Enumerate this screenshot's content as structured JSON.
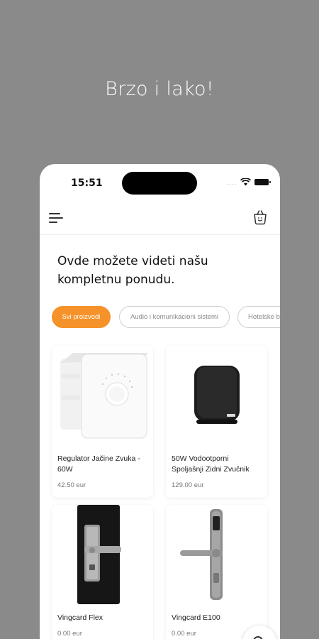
{
  "headline": "Brzo i lako!",
  "status_bar": {
    "time": "15:51",
    "dots": "...."
  },
  "intro_text": "Ovde možete videti našu kompletnu ponudu.",
  "categories": [
    {
      "label": "Svi proizvodi",
      "active": true
    },
    {
      "label": "Audio i komunikacioni sistemi",
      "active": false
    },
    {
      "label": "Hotelske b",
      "active": false
    }
  ],
  "products": [
    {
      "name": "Regulator Jačine Zvuka - 60W",
      "price": "42.50 eur",
      "image": "volume-regulator"
    },
    {
      "name": "50W Vodootporni Spoljašnji Zidni Zvučnik",
      "price": "129.00 eur",
      "image": "wall-speaker"
    },
    {
      "name": "Vingcard Flex",
      "price": "0.00 eur",
      "image": "door-lock-flex"
    },
    {
      "name": "Vingcard E100",
      "price": "0.00 eur",
      "image": "door-lock-e100"
    }
  ],
  "colors": {
    "accent": "#f5922a",
    "background": "#8a8a8a"
  },
  "icons": {
    "menu": "menu-icon",
    "basket": "basket-icon",
    "search": "search-icon"
  }
}
